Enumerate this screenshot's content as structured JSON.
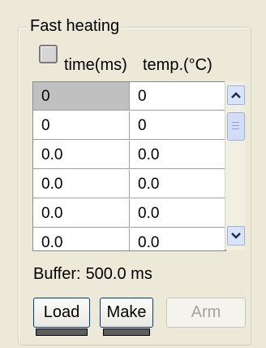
{
  "group": {
    "title": "Fast heating"
  },
  "checkbox": {
    "checked": false
  },
  "headers": {
    "time": "time(ms)",
    "temp": "temp.(°C)"
  },
  "table": {
    "rows": [
      {
        "time": "0",
        "temp": "0",
        "selected": true
      },
      {
        "time": "0",
        "temp": "0"
      },
      {
        "time": "0.0",
        "temp": "0.0"
      },
      {
        "time": "0.0",
        "temp": "0.0"
      },
      {
        "time": "0.0",
        "temp": "0.0"
      },
      {
        "time": "0.0",
        "temp": "0.0"
      }
    ]
  },
  "buffer": {
    "label": "Buffer:",
    "value": "500.0 ms"
  },
  "buttons": {
    "load": "Load",
    "make": "Make",
    "arm": "Arm"
  },
  "colors": {
    "accent": "#003c74",
    "selected_cell": "#c0c0c0",
    "indicator": "#5e5e5e"
  }
}
